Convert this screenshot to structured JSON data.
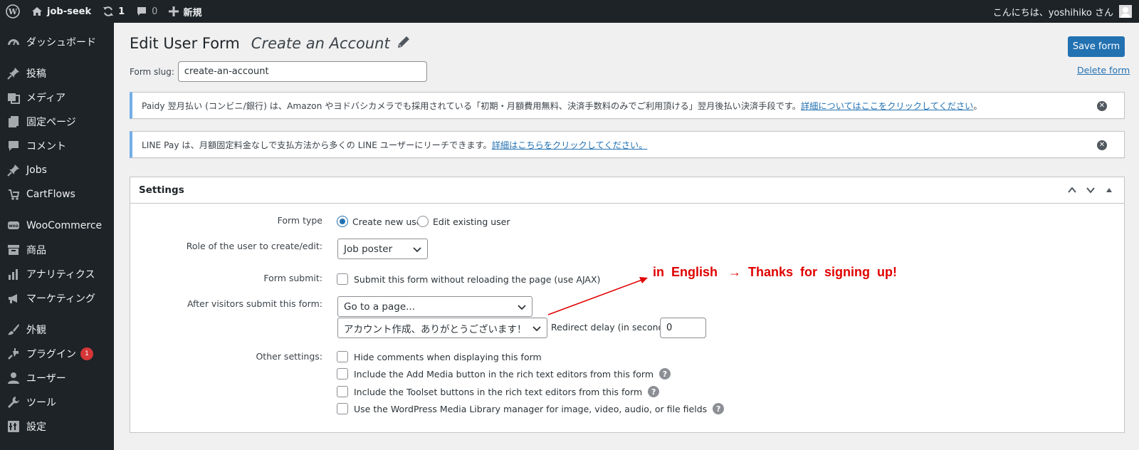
{
  "adminbar": {
    "site_name": "job-seek",
    "updates_count": "1",
    "comments_count": "0",
    "new_label": "新規",
    "greeting": "こんにちは、yoshihiko さん"
  },
  "sidebar": {
    "items": [
      {
        "label": "ダッシュボード",
        "icon": "dashboard-icon"
      },
      {
        "label": "投稿",
        "icon": "pin-icon"
      },
      {
        "label": "メディア",
        "icon": "media-icon"
      },
      {
        "label": "固定ページ",
        "icon": "page-icon"
      },
      {
        "label": "コメント",
        "icon": "comment-icon"
      },
      {
        "label": "Jobs",
        "icon": "pin-icon"
      },
      {
        "label": "CartFlows",
        "icon": "cartflows-icon"
      },
      {
        "label": "WooCommerce",
        "icon": "woo-icon"
      },
      {
        "label": "商品",
        "icon": "archive-icon"
      },
      {
        "label": "アナリティクス",
        "icon": "bar-chart-icon"
      },
      {
        "label": "マーケティング",
        "icon": "megaphone-icon"
      },
      {
        "label": "外観",
        "icon": "brush-icon"
      },
      {
        "label": "プラグイン",
        "icon": "plugin-icon",
        "badge": "1"
      },
      {
        "label": "ユーザー",
        "icon": "user-icon"
      },
      {
        "label": "ツール",
        "icon": "wrench-icon"
      },
      {
        "label": "設定",
        "icon": "settings-icon"
      }
    ]
  },
  "header": {
    "title": "Edit User Form",
    "form_name": "Create an Account",
    "slug_label": "Form slug:",
    "slug_value": "create-an-account",
    "save_label": "Save form",
    "delete_label": "Delete form"
  },
  "notices": [
    {
      "text": "Paidy 翌月払い (コンビニ/銀行) は、Amazon やヨドバシカメラでも採用されている「初期・月額費用無料、決済手数料のみでご利用頂ける」翌月後払い決済手段です。",
      "link": "詳細についてはここをクリックしてください",
      "suffix": "。"
    },
    {
      "text": "LINE Pay は、月額固定料金なしで支払方法から多くの LINE ユーザーにリーチできます。",
      "link": "詳細はこちらをクリックしてください。",
      "suffix": ""
    }
  ],
  "settings": {
    "title": "Settings",
    "form_type_label": "Form type",
    "form_type_options": [
      "Create new user",
      "Edit existing user"
    ],
    "form_type_selected": "Create new user",
    "role_label": "Role of the user to create/edit:",
    "role_value": "Job poster",
    "submit_label": "Form submit:",
    "ajax_label": "Submit this form without reloading the page (use AJAX)",
    "after_label": "After visitors submit this form:",
    "after_value": "Go to a page...",
    "page_value": "アカウント作成、ありがとうございます！",
    "delay_label": "Redirect delay (in seconds)",
    "delay_value": "0",
    "other_label": "Other settings:",
    "other_options": [
      "Hide comments when displaying this form",
      "Include the Add Media button in the rich text editors from this form",
      "Include the Toolset buttons in the rich text editors from this form",
      "Use the WordPress Media Library manager for image, video, audio, or file fields"
    ]
  },
  "annotation": {
    "text": "in  English   →  Thanks  for  signing  up!",
    "color": "#e00000"
  },
  "colors": {
    "accent": "#2271b1",
    "adminbar": "#1d2327",
    "notice_border": "#72aee6"
  }
}
